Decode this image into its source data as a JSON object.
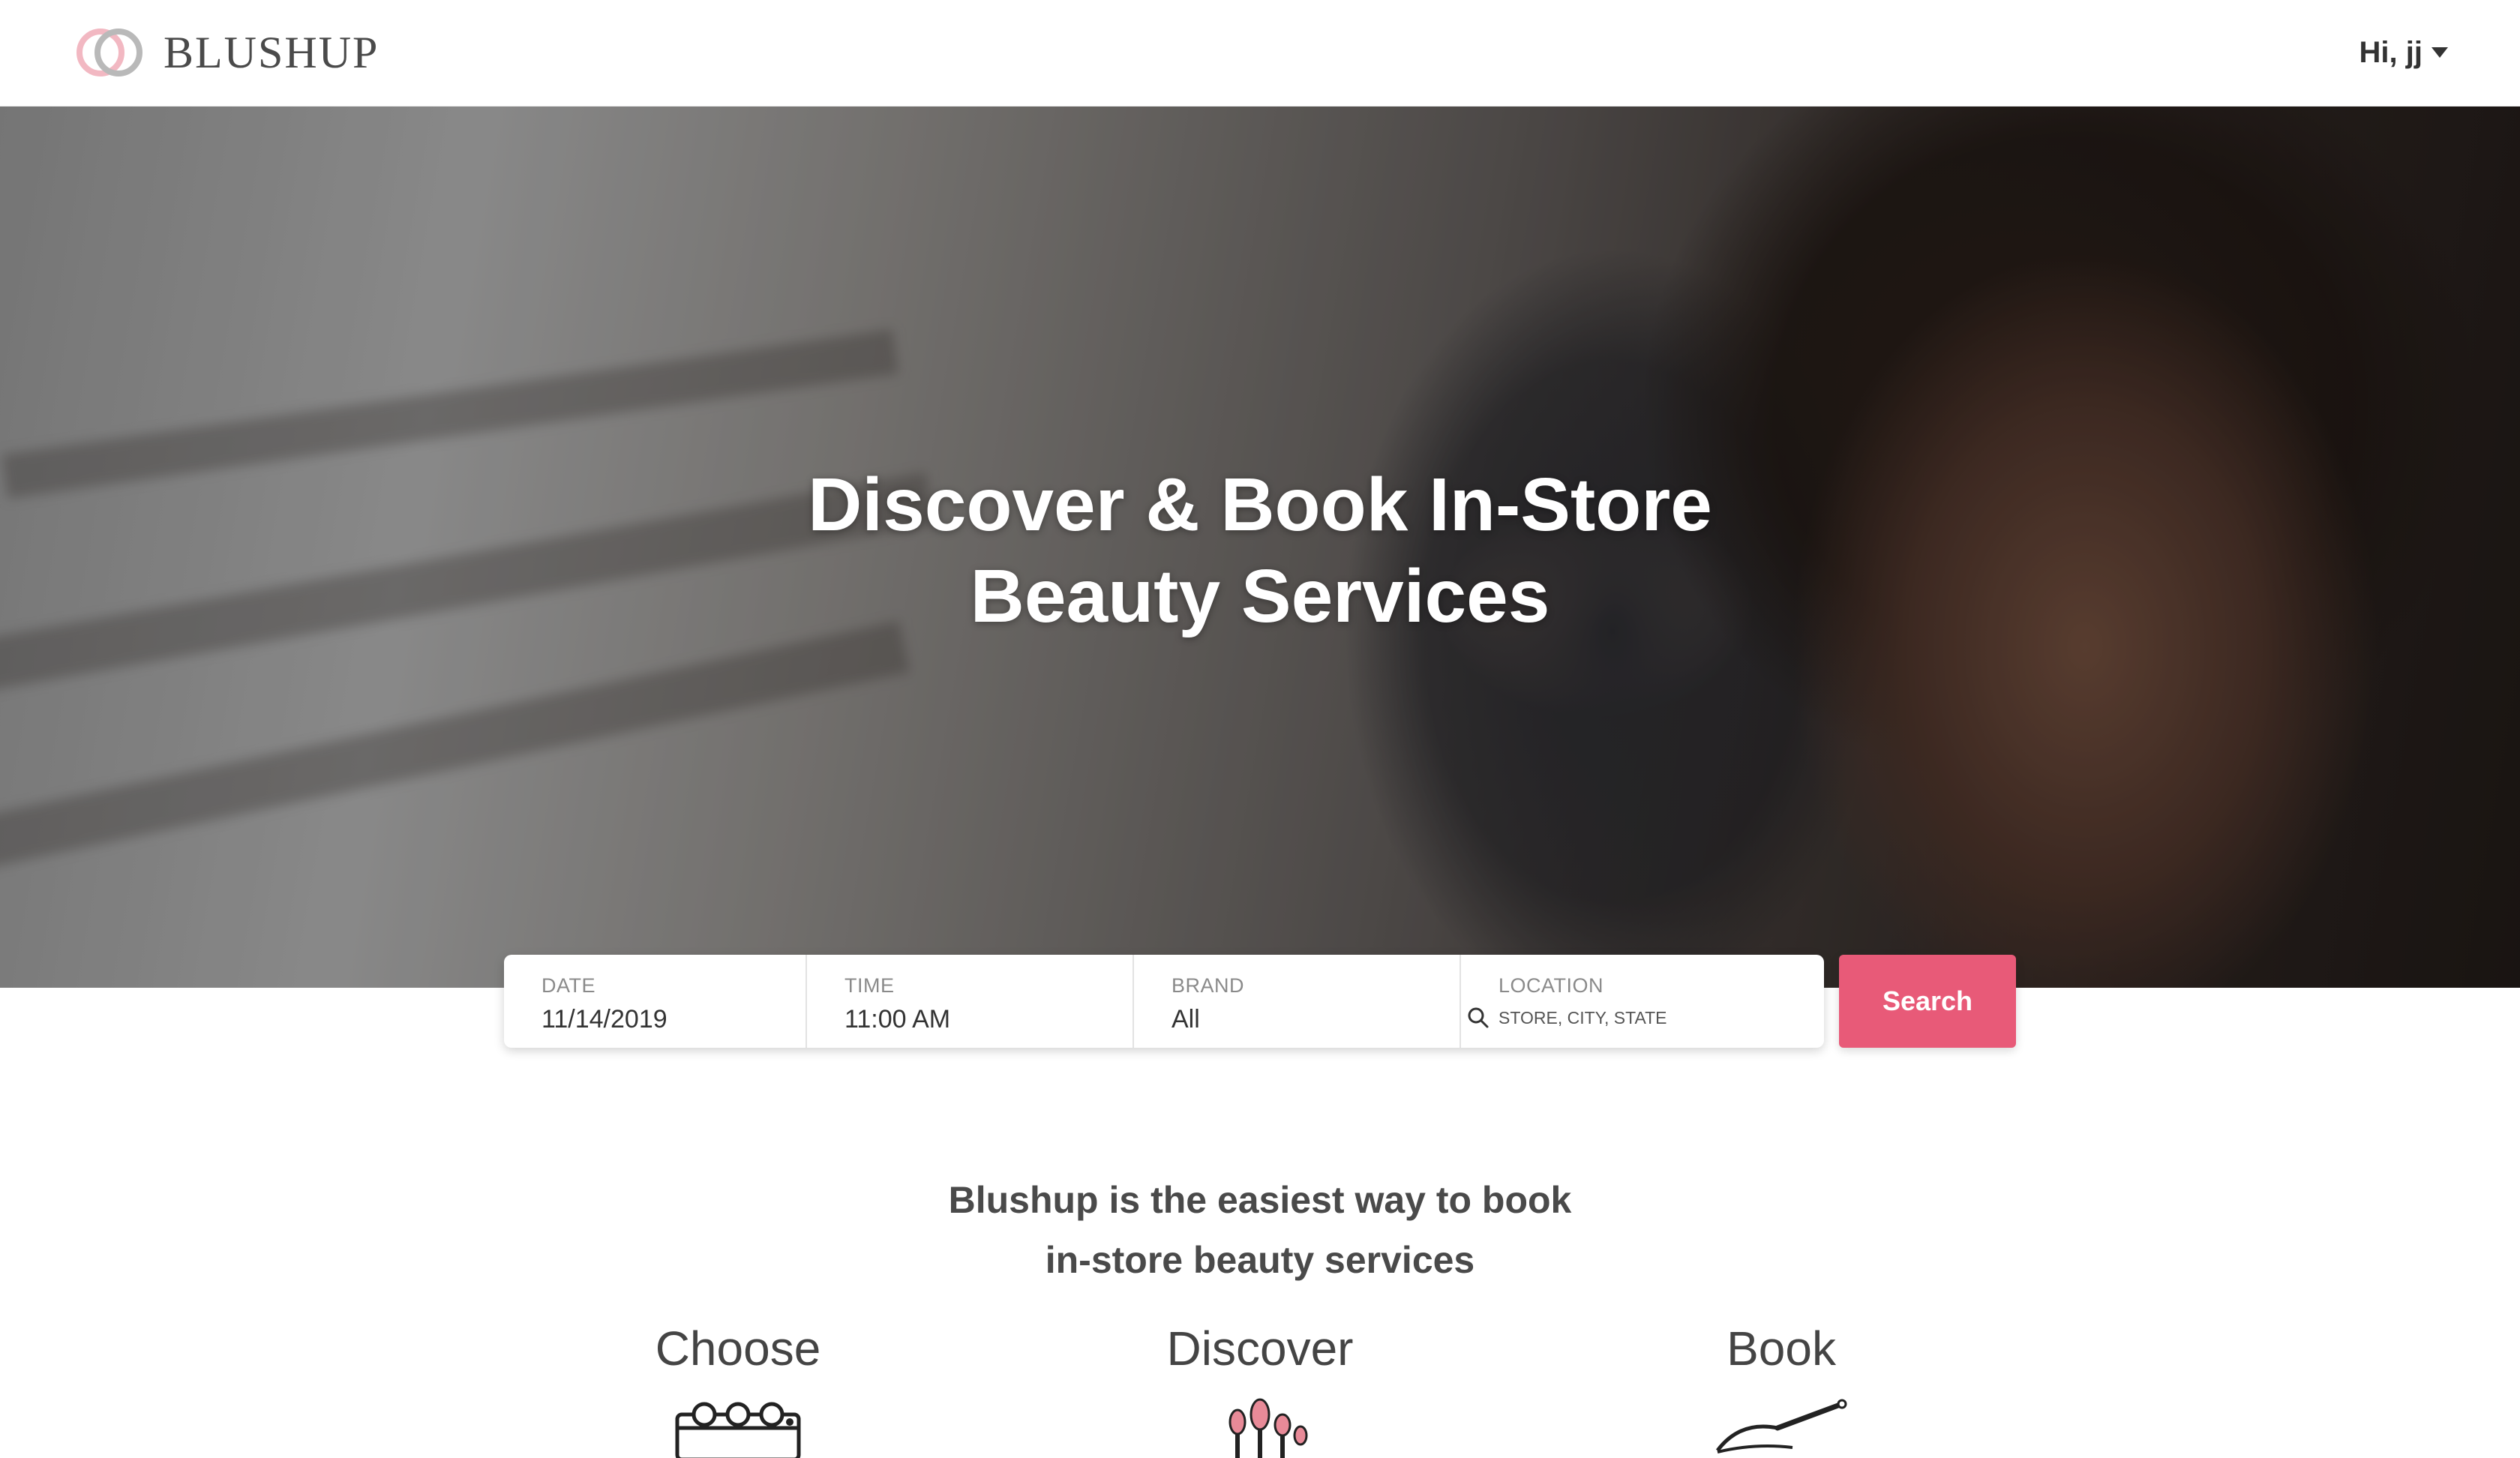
{
  "header": {
    "logo_text": "BLUSHUP",
    "user_greeting": "Hi, jj"
  },
  "hero": {
    "title_line1": "Discover & Book In-Store",
    "title_line2": "Beauty Services"
  },
  "search": {
    "date_label": "DATE",
    "date_value": "11/14/2019",
    "time_label": "TIME",
    "time_value": "11:00 AM",
    "brand_label": "BRAND",
    "brand_value": "All",
    "location_label": "LOCATION",
    "location_placeholder": "STORE, CITY, STATE",
    "button_label": "Search"
  },
  "info": {
    "tagline_line1": "Blushup is the easiest way to book",
    "tagline_line2": "in-store beauty services",
    "steps": [
      {
        "title": "Choose",
        "icon": "makeup-palette-icon"
      },
      {
        "title": "Discover",
        "icon": "makeup-brushes-icon"
      },
      {
        "title": "Book",
        "icon": "makeup-brush-icon"
      }
    ]
  },
  "colors": {
    "accent": "#e85a78",
    "logo_pink": "#f2b8c2",
    "logo_gray": "#b9b9b9",
    "text_dark": "#333333"
  }
}
